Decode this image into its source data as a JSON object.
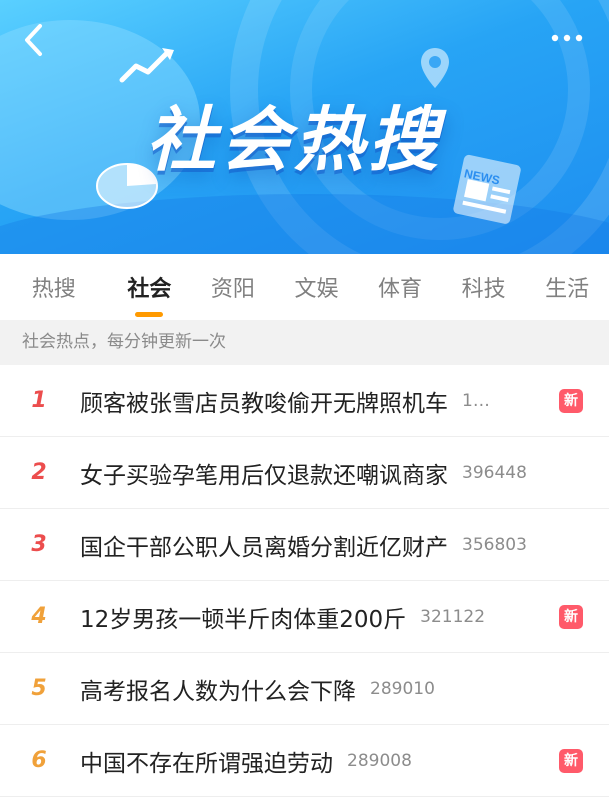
{
  "colors": {
    "banner_blue": "#27a4f5",
    "tab_indicator": "#ff9a00",
    "rank_top": "#ec4d4d",
    "rank_other": "#f0a13a",
    "badge_new": "#ff5a6a"
  },
  "header": {
    "back_icon": "chevron-left-icon",
    "more_icon": "more-dots-icon",
    "title": "社会热搜"
  },
  "tabs": [
    {
      "label": "热搜",
      "active": false
    },
    {
      "label": "社会",
      "active": true
    },
    {
      "label": "资阳",
      "active": false
    },
    {
      "label": "文娱",
      "active": false
    },
    {
      "label": "体育",
      "active": false
    },
    {
      "label": "科技",
      "active": false
    },
    {
      "label": "生活",
      "active": false
    }
  ],
  "notice": "社会热点，每分钟更新一次",
  "items": [
    {
      "rank": "1",
      "title": "顾客被张雪店员教唆偷开无牌照机车",
      "count": "1…",
      "badge": "新"
    },
    {
      "rank": "2",
      "title": "女子买验孕笔用后仅退款还嘲讽商家",
      "count": "396448",
      "badge": ""
    },
    {
      "rank": "3",
      "title": "国企干部公职人员离婚分割近亿财产",
      "count": "356803",
      "badge": ""
    },
    {
      "rank": "4",
      "title": "12岁男孩一顿半斤肉体重200斤",
      "count": "321122",
      "badge": "新"
    },
    {
      "rank": "5",
      "title": "高考报名人数为什么会下降",
      "count": "289010",
      "badge": ""
    },
    {
      "rank": "6",
      "title": "中国不存在所谓强迫劳动",
      "count": "289008",
      "badge": "新"
    }
  ],
  "decor": {
    "chart_icon": "trend-chart-icon",
    "pin_icon": "location-pin-icon",
    "pie_icon": "pie-chart-icon",
    "news_icon": "newspaper-icon",
    "news_label": "NEWS"
  }
}
